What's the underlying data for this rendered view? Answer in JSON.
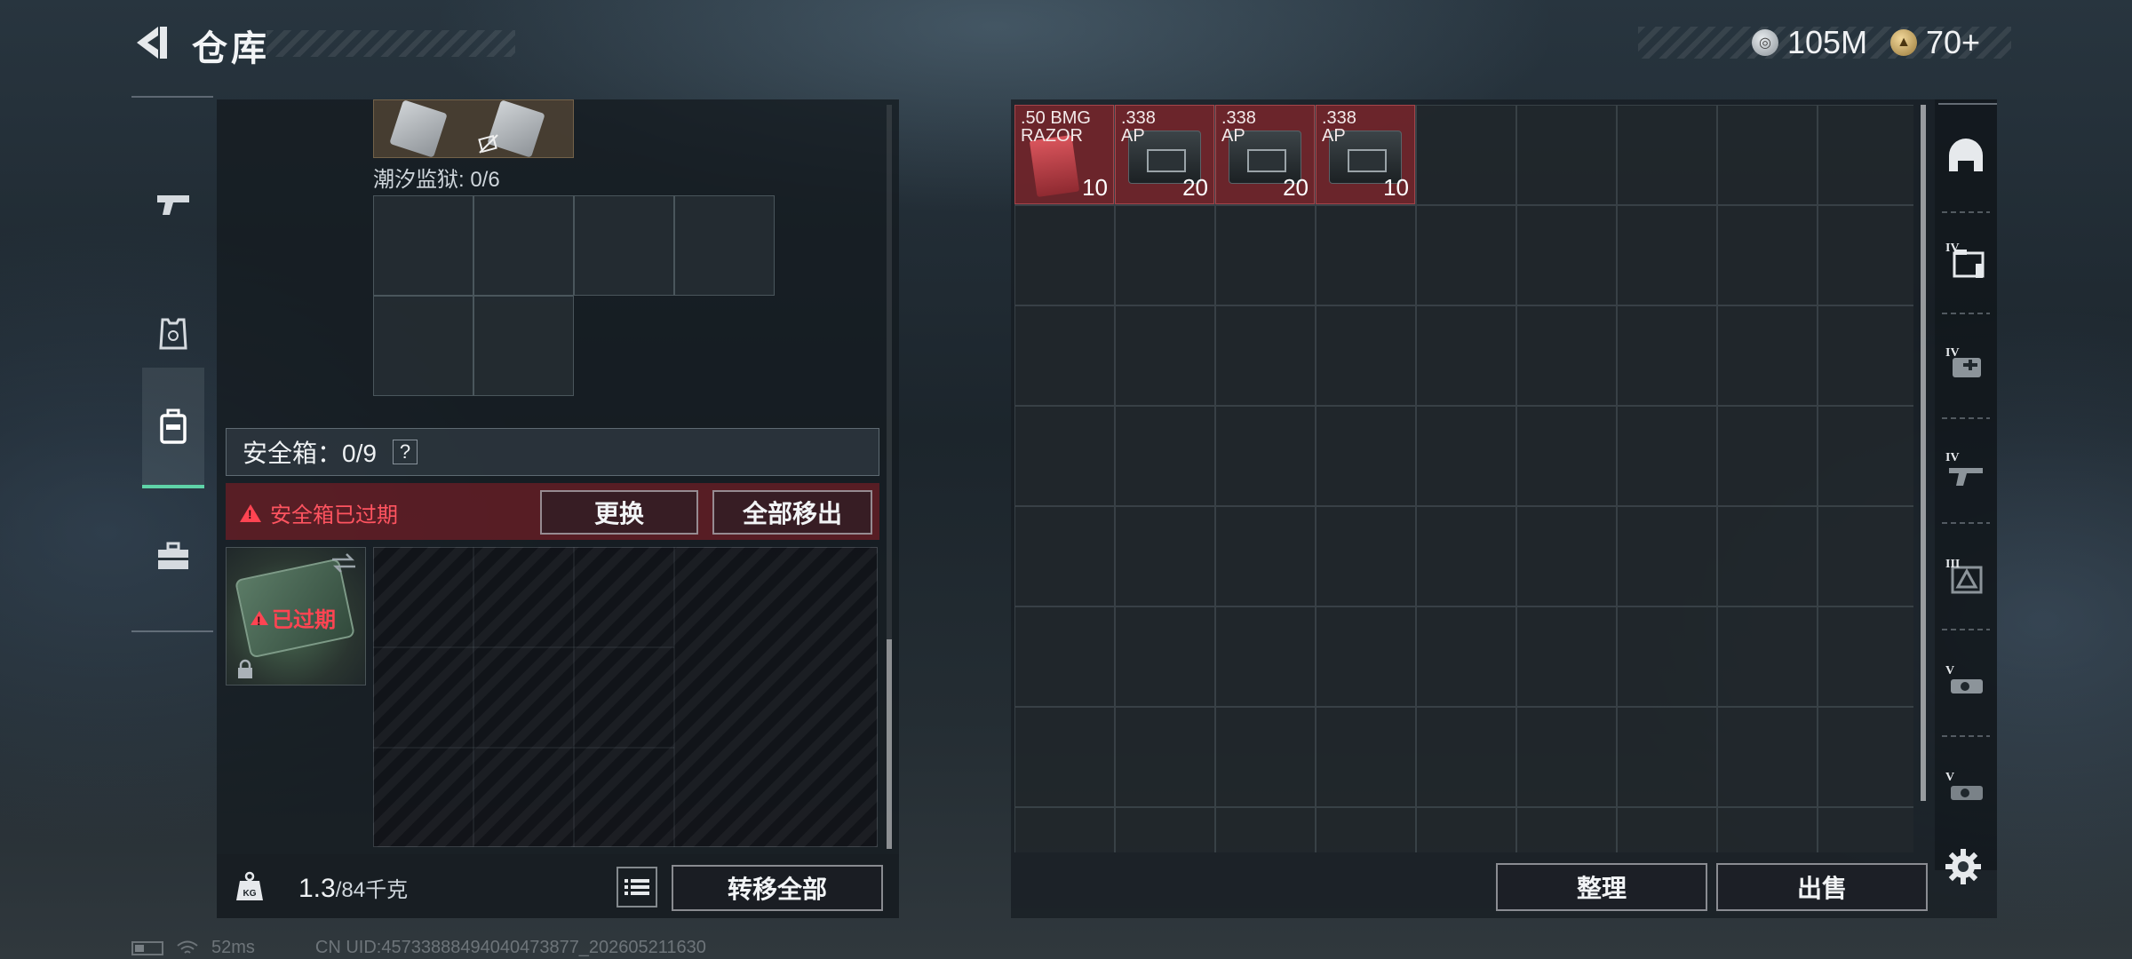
{
  "header": {
    "title": "仓库",
    "currencies": [
      {
        "icon": "silver-coin-icon",
        "value": "105M"
      },
      {
        "icon": "gold-coin-icon",
        "value": "70+"
      }
    ]
  },
  "rail": {
    "items": [
      {
        "name": "weapons",
        "icon": "pistol-icon",
        "active": false
      },
      {
        "name": "armor",
        "icon": "armor-vest-icon",
        "active": false
      },
      {
        "name": "backpack",
        "icon": "backpack-icon",
        "active": true
      },
      {
        "name": "toolbox",
        "icon": "toolbox-icon",
        "active": false
      }
    ]
  },
  "left": {
    "tidal_label": "潮汐监狱: 0/6",
    "safe_header": "安全箱：0/9",
    "help": "?",
    "expired_notice": "安全箱已过期",
    "replace_button": "更换",
    "remove_all_button": "全部移出",
    "case_status": "已过期",
    "weight_current": "1.3",
    "weight_total": "/84千克",
    "kg_label": "KG",
    "transfer_all_button": "转移全部"
  },
  "stash": {
    "items": [
      {
        "label": ".50 BMG\nRAZOR",
        "count": "10",
        "kind": "red"
      },
      {
        "label": ".338\nAP",
        "count": "20",
        "kind": "box"
      },
      {
        "label": ".338\nAP",
        "count": "20",
        "kind": "box"
      },
      {
        "label": ".338\nAP",
        "count": "10",
        "kind": "box"
      }
    ],
    "sort_button": "整理",
    "sell_button": "出售"
  },
  "side_tabs": {
    "items": [
      {
        "icon": "helmet-icon",
        "tier": ""
      },
      {
        "icon": "folder-tier-iv-icon",
        "tier": "IV"
      },
      {
        "icon": "medkit-tier-iv-icon",
        "tier": "IV"
      },
      {
        "icon": "gun-tier-iv-icon",
        "tier": "IV"
      },
      {
        "icon": "warning-crate-tier-iii-icon",
        "tier": "III"
      },
      {
        "icon": "scope-tier-v-icon",
        "tier": "V"
      },
      {
        "icon": "scope-tier-v-alt-icon",
        "tier": "V"
      }
    ]
  },
  "status": {
    "ping": "52ms",
    "uid": "CN UID:45733888494040473877_202605211630"
  },
  "colors": {
    "accent_green": "#5fd3a8",
    "warning_red": "#ff4452",
    "item_red": "#78262c"
  }
}
